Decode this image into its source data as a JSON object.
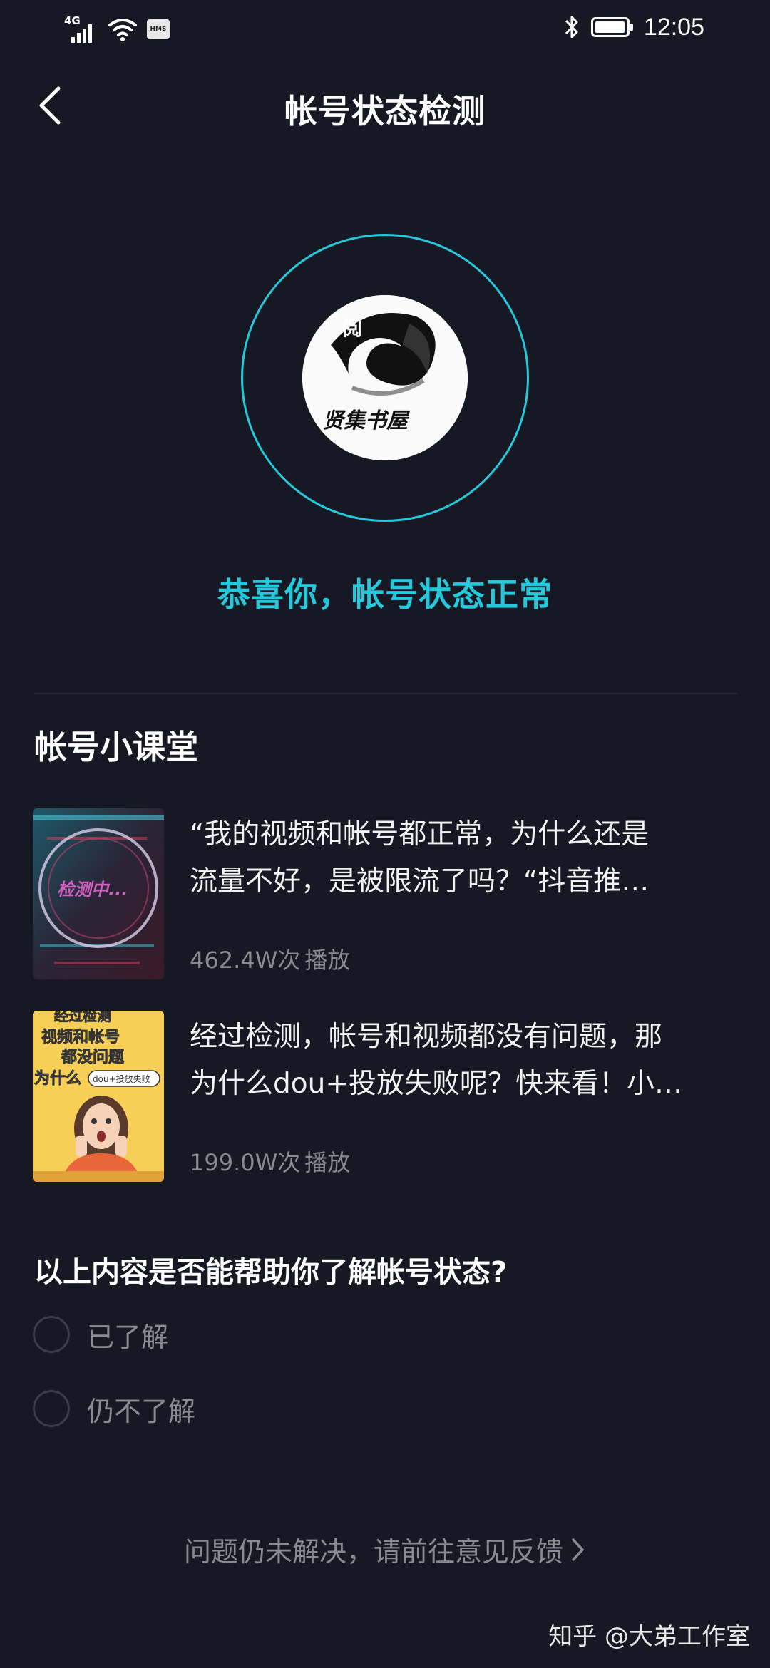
{
  "status_bar": {
    "network": "4G",
    "badge": "HMS",
    "time": "12:05",
    "battery_level": 0.85,
    "icons": [
      "signal-icon",
      "wifi-icon",
      "hms-icon",
      "bluetooth-icon",
      "battery-icon"
    ]
  },
  "header": {
    "title": "帐号状态检测",
    "back_icon": "chevron-left-icon"
  },
  "account": {
    "status_message": "恭喜你，帐号状态正常",
    "ring_color": "#25c9dc",
    "avatar_text": "阅读 贤集书屋"
  },
  "course_section": {
    "title": "帐号小课堂",
    "items": [
      {
        "title_line1": "“我的视频和帐号都正常，为什么还是",
        "title_line2": "流量不好，是被限流了吗？“抖音推…",
        "plays": "462.4W次",
        "plays_suffix": "播放",
        "thumb_text": "检测中..."
      },
      {
        "title_line1": "经过检测，帐号和视频都没有问题，那",
        "title_line2": "为什么dou+投放失败呢？快来看！小…",
        "plays": "199.0W次",
        "plays_suffix": "播放",
        "thumb_text_1": "经过检测",
        "thumb_text_2": "视频和帐号",
        "thumb_text_3": "都没问题",
        "thumb_text_4": "为什么",
        "thumb_text_5": "dou+投放失败"
      }
    ]
  },
  "survey": {
    "question": "以上内容是否能帮助你了解帐号状态?",
    "options": [
      "已了解",
      "仍不了解"
    ]
  },
  "feedback": {
    "label": "问题仍未解决，请前往意见反馈"
  },
  "watermark": "知乎 @大弟工作室",
  "colors": {
    "background": "#161823",
    "accent": "#25c9dc",
    "muted_text": "#8a8b91"
  }
}
